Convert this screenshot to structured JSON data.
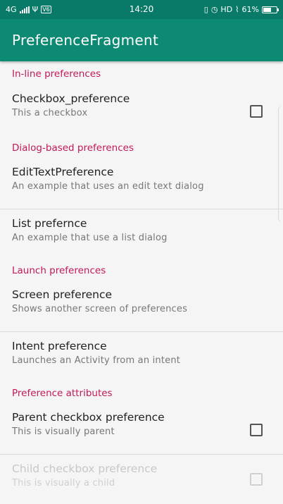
{
  "status_bar": {
    "network": "4G",
    "usb_icon": "usb-icon",
    "time": "14:20",
    "hd": "HD",
    "battery_percent": "61%",
    "battery_level": 0.61
  },
  "app_bar": {
    "title": "PreferenceFragment"
  },
  "sections": {
    "inline": {
      "header": "In-line preferences",
      "checkbox_pref": {
        "title": "Checkbox_preference",
        "summary": "This a checkbox",
        "checked": false
      }
    },
    "dialog": {
      "header": "Dialog-based preferences",
      "edit_text": {
        "title": "EditTextPreference",
        "summary": "An example that uses an edit text dialog"
      },
      "list": {
        "title": "List prefernce",
        "summary": "An example that use a list dialog"
      }
    },
    "launch": {
      "header": "Launch preferences",
      "screen": {
        "title": "Screen preference",
        "summary": "Shows another screen of preferences"
      },
      "intent": {
        "title": "Intent preference",
        "summary": "Launches an Activity from an intent"
      }
    },
    "attributes": {
      "header": "Preference attributes",
      "parent": {
        "title": "Parent checkbox preference",
        "summary": "This is visually parent",
        "checked": false
      },
      "child": {
        "title": "Child checkbox preference",
        "summary": "This is visually a child",
        "checked": false,
        "enabled": false
      }
    }
  }
}
